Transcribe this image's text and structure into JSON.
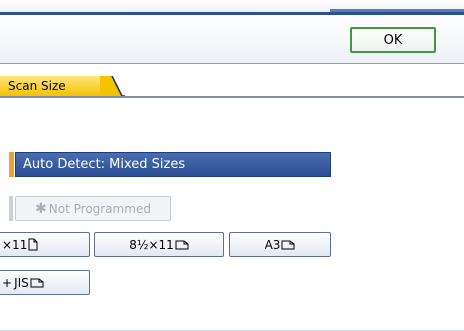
{
  "header": {
    "ok_label": "OK"
  },
  "tabs": {
    "scan_size": "Scan Size"
  },
  "scan_options": {
    "auto_detect": "Auto Detect: Mixed Sizes",
    "not_programmed": "Not Programmed",
    "size_row1": [
      "×11",
      "8½×11",
      "A3"
    ],
    "size_row2": [
      "JIS"
    ]
  },
  "icons": {
    "not_programmed": "star-icon",
    "portrait": "paper-portrait-icon",
    "landscape": "paper-landscape-icon"
  },
  "colors": {
    "selected_bg": "#2b4f92",
    "tab_yellow": "#f5c200",
    "ok_border": "#3f9a3f",
    "marker_orange": "#f0a030"
  }
}
